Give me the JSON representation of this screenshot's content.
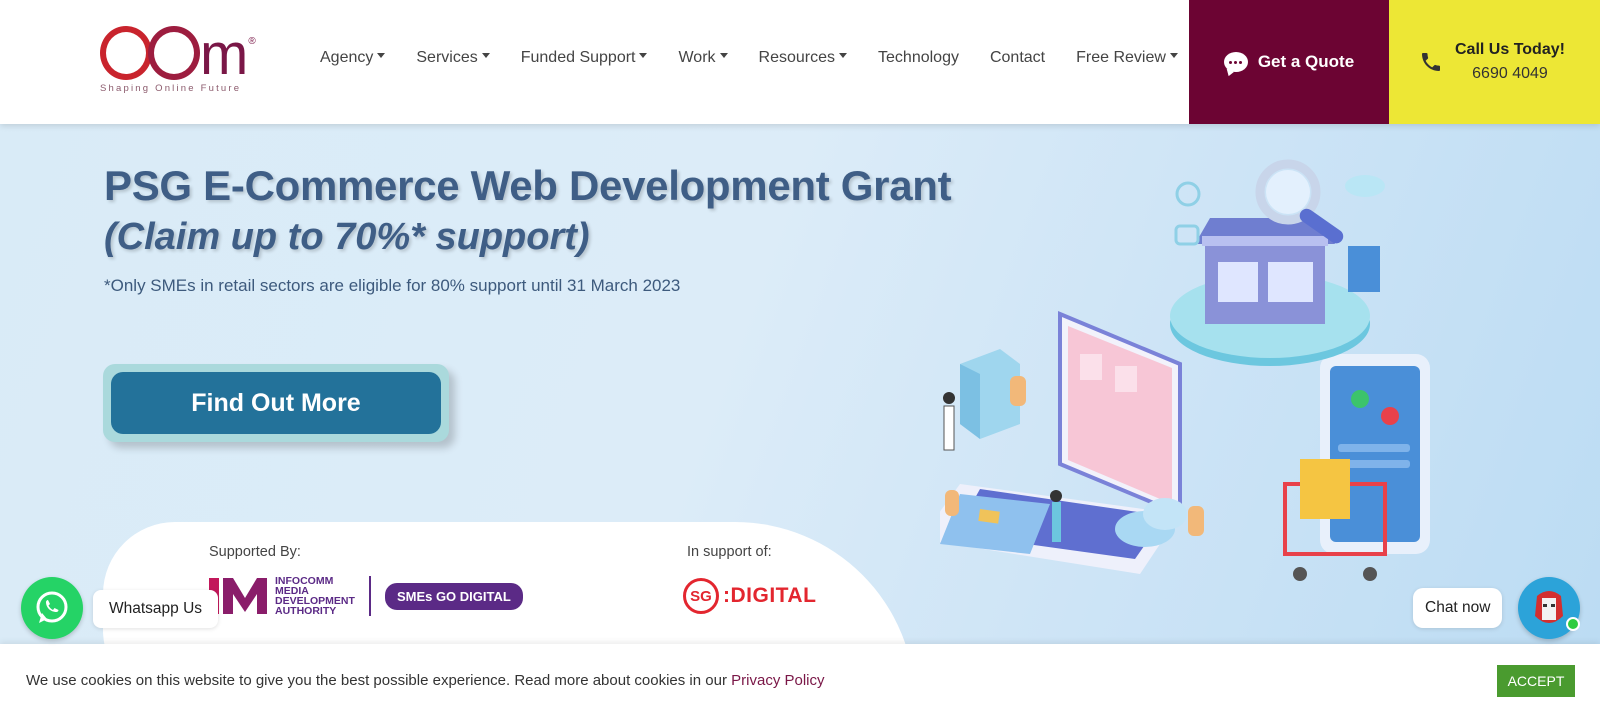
{
  "header": {
    "logo": {
      "tagline": "Shaping Online Future",
      "reg": "®"
    },
    "nav": [
      {
        "label": "Agency",
        "has_dropdown": true
      },
      {
        "label": "Services",
        "has_dropdown": true
      },
      {
        "label": "Funded Support",
        "has_dropdown": true
      },
      {
        "label": "Work",
        "has_dropdown": true
      },
      {
        "label": "Resources",
        "has_dropdown": true
      },
      {
        "label": "Technology",
        "has_dropdown": false
      },
      {
        "label": "Contact",
        "has_dropdown": false
      },
      {
        "label": "Free Review",
        "has_dropdown": true
      }
    ],
    "quote_button": {
      "label": "Get a Quote",
      "icon": "chat-bubble-icon",
      "color": "#6c0433"
    },
    "call": {
      "title": "Call Us Today!",
      "number": "6690 4049",
      "icon": "phone-icon",
      "color": "#ede735"
    }
  },
  "hero": {
    "title": "PSG E-Commerce Web Development Grant",
    "subtitle": "(Claim up to 70%* support)",
    "note": "*Only SMEs in retail sectors are eligible for 80% support until 31 March 2023",
    "cta_label": "Find Out More",
    "supported_by_label": "Supported By:",
    "in_support_of_label": "In support of:",
    "imda_text": [
      "INFOCOMM",
      "MEDIA",
      "DEVELOPMENT",
      "AUTHORITY"
    ],
    "smes_badge": "SMEs GO DIGITAL",
    "sg_digital": {
      "circle": "SG",
      "text": ":DIGITAL"
    }
  },
  "widgets": {
    "whatsapp_label": "Whatsapp Us",
    "chat_label": "Chat now"
  },
  "cookie": {
    "text": "We use cookies on this website to give you the best possible experience. Read more about cookies in our",
    "link": "Privacy Policy",
    "accept": "ACCEPT"
  }
}
